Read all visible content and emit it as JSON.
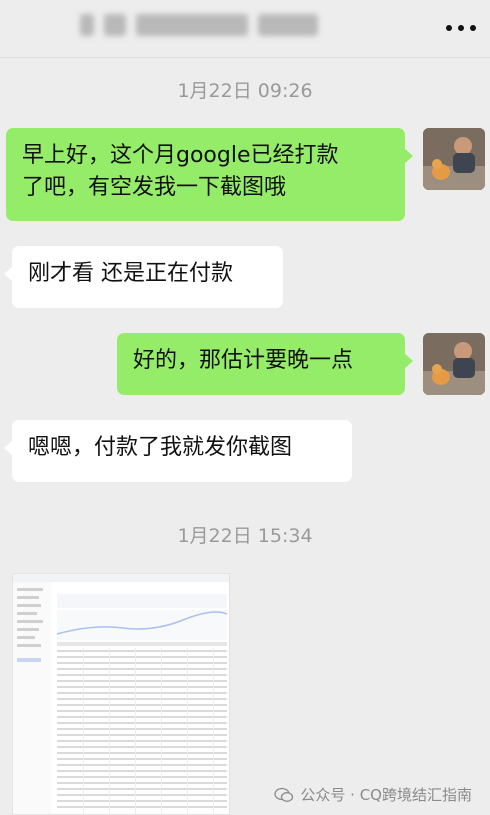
{
  "header": {
    "title_blurred": true,
    "more_icon": "more-dots-icon"
  },
  "messages": [
    {
      "type": "time",
      "text": "1月22日 09:26"
    },
    {
      "type": "msg",
      "side": "me",
      "text_line1": "早上好，这个月google已经打款",
      "text_line2": "了吧，有空发我一下截图哦"
    },
    {
      "type": "msg",
      "side": "them",
      "text": "刚才看 还是正在付款"
    },
    {
      "type": "msg",
      "side": "me",
      "text": "好的，那估计要晚一点"
    },
    {
      "type": "msg",
      "side": "them",
      "text": "嗯嗯，付款了我就发你截图"
    },
    {
      "type": "time",
      "text": "1月22日 15:34"
    },
    {
      "type": "image",
      "side": "them",
      "content": "screenshot-thumbnail"
    }
  ],
  "watermark": {
    "text": "公众号 · CQ跨境结汇指南",
    "icon": "wechat-icon"
  },
  "colors": {
    "me_bubble": "#95ec69",
    "them_bubble": "#ffffff",
    "background": "#ededed",
    "time": "#9a9a9a"
  }
}
